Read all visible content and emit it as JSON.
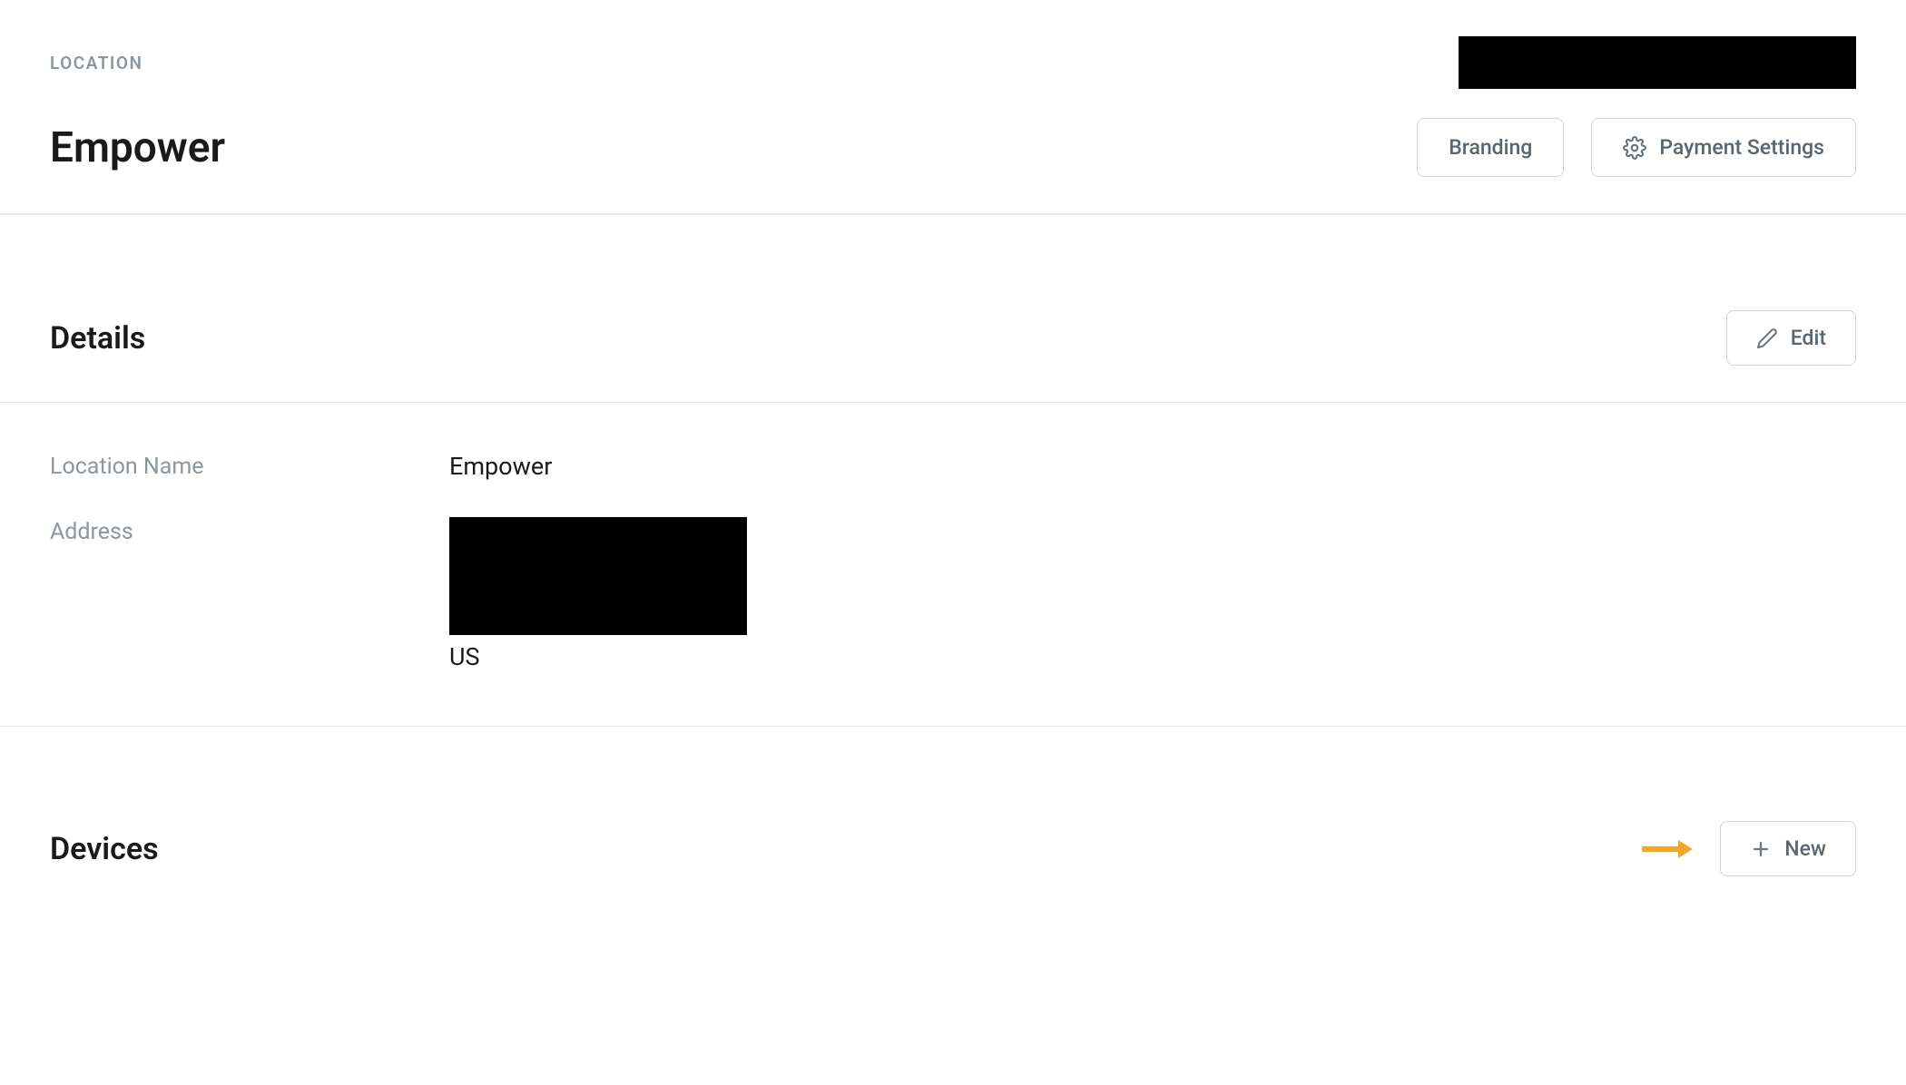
{
  "breadcrumb": {
    "label": "LOCATION"
  },
  "header": {
    "title": "Empower",
    "branding_label": "Branding",
    "payment_settings_label": "Payment Settings"
  },
  "details": {
    "section_title": "Details",
    "edit_label": "Edit",
    "fields": {
      "location_name": {
        "label": "Location Name",
        "value": "Empower"
      },
      "address": {
        "label": "Address",
        "country": "US"
      }
    }
  },
  "devices": {
    "section_title": "Devices",
    "new_label": "New"
  }
}
